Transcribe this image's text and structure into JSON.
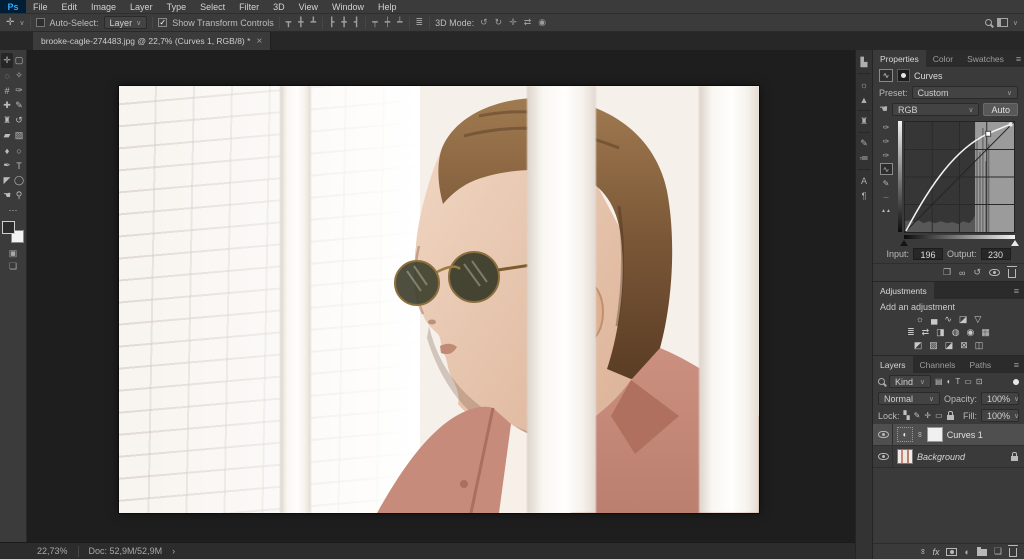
{
  "app": {
    "logo_text": "Ps"
  },
  "menu": {
    "items": [
      "File",
      "Edit",
      "Image",
      "Layer",
      "Type",
      "Select",
      "Filter",
      "3D",
      "View",
      "Window",
      "Help"
    ]
  },
  "options": {
    "move_tool_glyph": "✛",
    "chevron": "∨",
    "auto_select_label": "Auto-Select:",
    "auto_select_value": "Layer",
    "check_glyph": "✓",
    "show_transform_label": "Show Transform Controls",
    "align_icons": [
      "┳",
      "╋",
      "┻",
      "┣",
      "╋",
      "┫",
      "┯",
      "┿",
      "┷"
    ],
    "distribute_icon": "≣",
    "mode_3d_label": "3D Mode:",
    "mode_3d_icons": [
      "↺",
      "↻",
      "✛",
      "⇄",
      "◉"
    ]
  },
  "document": {
    "tab_title": "brooke-cagle-274483.jpg @ 22,7% (Curves 1, RGB/8) *",
    "close_glyph": "×"
  },
  "tools": {
    "left": [
      "✛",
      "◌",
      "#",
      "✚",
      "♜",
      "▰",
      "♦",
      "✒",
      "◤",
      "☚"
    ],
    "right": [
      "▢",
      "✧",
      "✑",
      "✎",
      "↺",
      "▨",
      "○",
      "T",
      "◯",
      "⚲"
    ],
    "more_glyph": "⋯"
  },
  "dock": {
    "groups": [
      [
        "▙"
      ],
      [
        "☼",
        "▲"
      ],
      [
        "♜"
      ],
      [
        "✎",
        "≔"
      ],
      [
        "A",
        "¶"
      ]
    ]
  },
  "properties": {
    "tabs": [
      "Properties",
      "Color",
      "Swatches"
    ],
    "panel_menu": "≡",
    "title": "Curves",
    "preset_label": "Preset:",
    "preset_value": "Custom",
    "hand_glyph": "☚",
    "channel_value": "RGB",
    "auto_label": "Auto"
  },
  "curves": {
    "dropper_glyph": "✑",
    "edit_glyph": "∿",
    "pencil_glyph": "✎",
    "smooth_glyph": "∼",
    "clip_glyph": "▲▲",
    "input_label": "Input:",
    "input_value": "196",
    "output_label": "Output:",
    "output_value": "230",
    "points": [
      [
        0,
        0
      ],
      [
        196,
        230
      ],
      [
        255,
        255
      ]
    ],
    "bottom_icons": {
      "clip": "❐",
      "prev": "∞",
      "reset": "↺"
    }
  },
  "adjustments": {
    "tab": "Adjustments",
    "panel_menu": "≡",
    "heading": "Add an adjustment",
    "rows": [
      [
        "☼",
        "▄",
        "∿",
        "◪",
        "▽"
      ],
      [
        "≣",
        "⇄",
        "◨",
        "◍",
        "◉",
        "▦"
      ],
      [
        "◩",
        "▨",
        "◪",
        "⊠",
        "◫"
      ]
    ]
  },
  "layers": {
    "tabs": [
      "Layers",
      "Channels",
      "Paths"
    ],
    "panel_menu": "≡",
    "filter_value": "Kind",
    "filter_icons": [
      "▤",
      "◐",
      "T",
      "▭",
      "⊡"
    ],
    "blend_mode": "Normal",
    "opacity_label": "Opacity:",
    "opacity_value": "100%",
    "lock_label": "Lock:",
    "lock_icons": [
      "▚",
      "✎",
      "✛",
      "▭"
    ],
    "fill_label": "Fill:",
    "fill_value": "100%",
    "adj_thumb_glyph": "◐",
    "chain_glyph": "∞",
    "items": [
      {
        "name": "Curves 1"
      },
      {
        "name": "Background"
      }
    ],
    "fx_label": "fx",
    "new_glyph": "❏"
  },
  "status": {
    "zoom": "22,73%",
    "doc": "Doc: 52,9M/52,9M",
    "arrow": "›"
  }
}
